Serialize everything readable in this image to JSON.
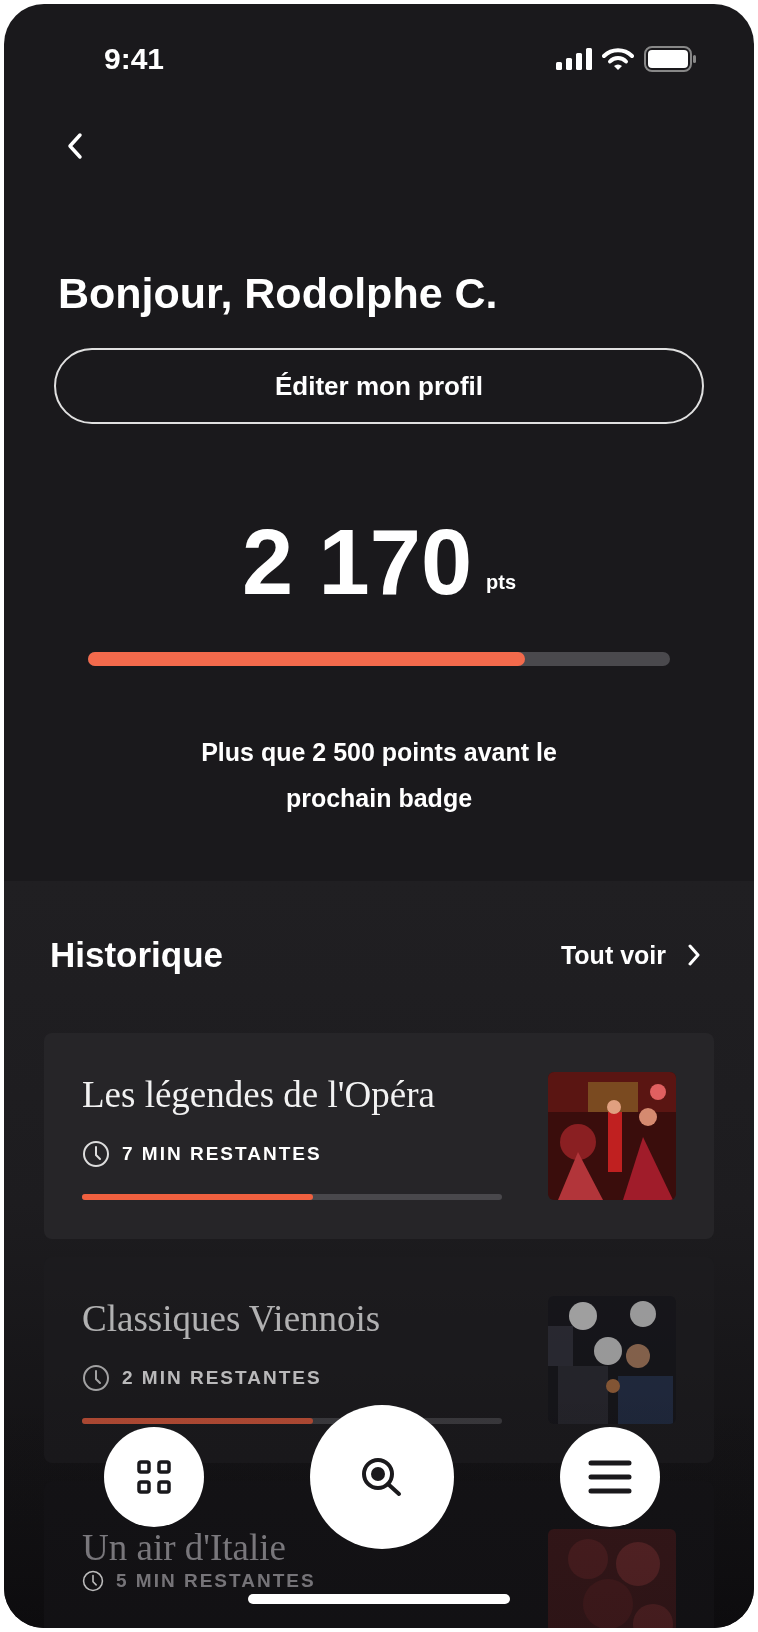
{
  "status_bar": {
    "time": "9:41"
  },
  "greeting": "Bonjour, Rodolphe C.",
  "edit_button": "Éditer mon profil",
  "points": {
    "value": "2 170",
    "unit": "pts",
    "level": 0.75,
    "caption": "Plus que 2 500 points avant le prochain badge"
  },
  "history": {
    "title": "Historique",
    "see_all": "Tout voir",
    "items": [
      {
        "title": "Les légendes de l'Opéra",
        "remaining": "7 MIN RESTANTES",
        "level": 0.55,
        "kind": "picture"
      },
      {
        "title": "Classiques Viennois",
        "remaining": "2 MIN RESTANTES",
        "level": 0.55,
        "kind": "picture"
      },
      {
        "title": "Un air d'Italie",
        "remaining": "5 MIN RESTANTES",
        "kind": "picture"
      }
    ]
  }
}
